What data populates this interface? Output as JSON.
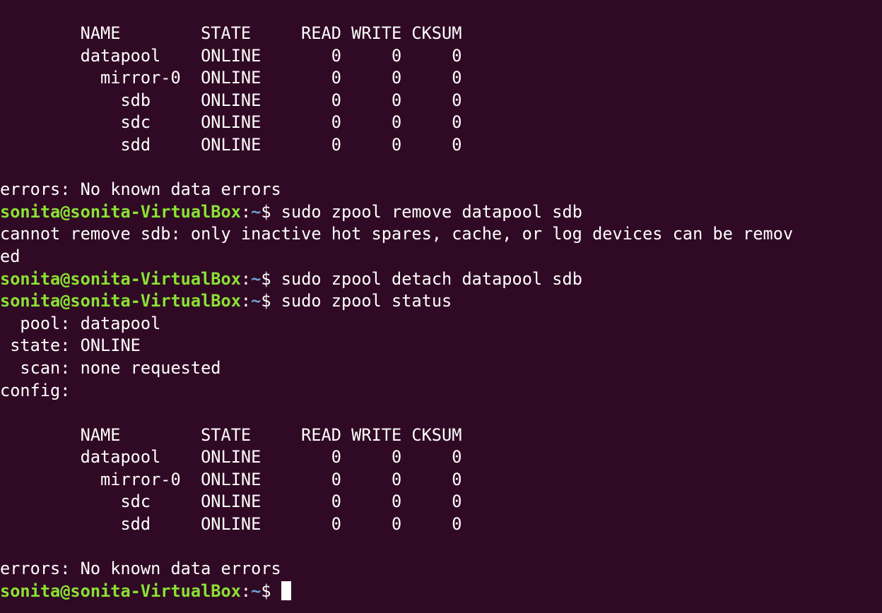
{
  "terminal": {
    "colors": {
      "background": "#300a24",
      "foreground": "#ffffff",
      "prompt_user": "#8ae234",
      "prompt_path": "#729fcf"
    },
    "lines": [
      {
        "type": "output",
        "text": "        NAME        STATE     READ WRITE CKSUM"
      },
      {
        "type": "output",
        "text": "        datapool    ONLINE       0     0     0"
      },
      {
        "type": "output",
        "text": "          mirror-0  ONLINE       0     0     0"
      },
      {
        "type": "output",
        "text": "            sdb     ONLINE       0     0     0"
      },
      {
        "type": "output",
        "text": "            sdc     ONLINE       0     0     0"
      },
      {
        "type": "output",
        "text": "            sdd     ONLINE       0     0     0"
      },
      {
        "type": "output",
        "text": ""
      },
      {
        "type": "output",
        "text": "errors: No known data errors"
      },
      {
        "type": "prompt",
        "user": "sonita@sonita-VirtualBox",
        "colon": ":",
        "path": "~",
        "sign": "$ ",
        "command": "sudo zpool remove datapool sdb"
      },
      {
        "type": "output",
        "text": "cannot remove sdb: only inactive hot spares, cache, or log devices can be remov"
      },
      {
        "type": "output",
        "text": "ed"
      },
      {
        "type": "prompt",
        "user": "sonita@sonita-VirtualBox",
        "colon": ":",
        "path": "~",
        "sign": "$ ",
        "command": "sudo zpool detach datapool sdb"
      },
      {
        "type": "prompt",
        "user": "sonita@sonita-VirtualBox",
        "colon": ":",
        "path": "~",
        "sign": "$ ",
        "command": "sudo zpool status"
      },
      {
        "type": "output",
        "text": "  pool: datapool"
      },
      {
        "type": "output",
        "text": " state: ONLINE"
      },
      {
        "type": "output",
        "text": "  scan: none requested"
      },
      {
        "type": "output",
        "text": "config:"
      },
      {
        "type": "output",
        "text": ""
      },
      {
        "type": "output",
        "text": "        NAME        STATE     READ WRITE CKSUM"
      },
      {
        "type": "output",
        "text": "        datapool    ONLINE       0     0     0"
      },
      {
        "type": "output",
        "text": "          mirror-0  ONLINE       0     0     0"
      },
      {
        "type": "output",
        "text": "            sdc     ONLINE       0     0     0"
      },
      {
        "type": "output",
        "text": "            sdd     ONLINE       0     0     0"
      },
      {
        "type": "output",
        "text": ""
      },
      {
        "type": "output",
        "text": "errors: No known data errors"
      },
      {
        "type": "prompt",
        "user": "sonita@sonita-VirtualBox",
        "colon": ":",
        "path": "~",
        "sign": "$ ",
        "command": "",
        "cursor": true
      }
    ]
  }
}
